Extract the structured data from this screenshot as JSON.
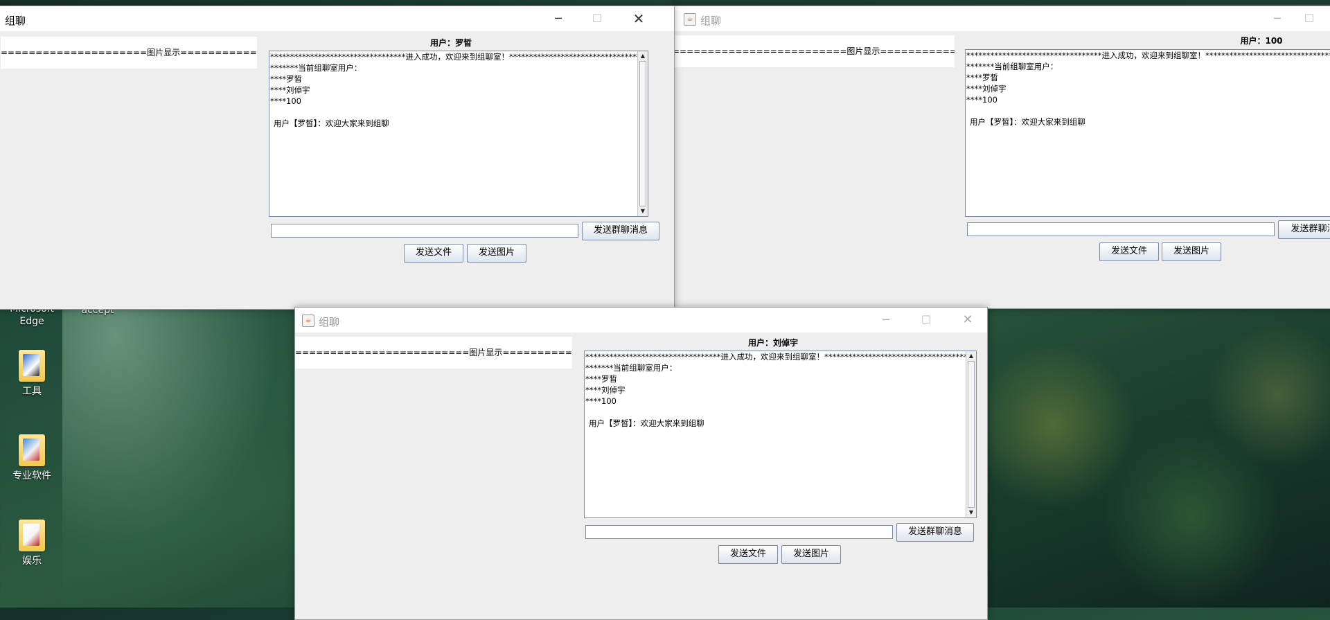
{
  "desktop": {
    "icons": [
      {
        "label_line1": "Microsoft",
        "label_line2": "Edge"
      },
      {
        "label": "accept"
      },
      {
        "label": "工具"
      },
      {
        "label": "专业软件"
      },
      {
        "label": "娱乐"
      }
    ]
  },
  "windows": {
    "w1": {
      "title": "组聊",
      "pic_header": "=====================图片显示=========================",
      "user_label": "用户：罗晳",
      "chat": [
        "**********************************进入成功，欢迎来到组聊室！************************************",
        "*******当前组聊室用户：",
        "****罗晳",
        "****刘倬宇",
        "****100",
        "用户【罗晳】：欢迎大家来到组聊"
      ],
      "send_group_label": "发送群聊消息",
      "send_file_label": "发送文件",
      "send_image_label": "发送图片"
    },
    "w2": {
      "title": "组聊",
      "pic_header": "=========================图片显示=========================",
      "user_label": "用户：100",
      "chat": [
        "**********************************进入成功，欢迎来到组聊室！************************************",
        "*******当前组聊室用户：",
        "****罗晳",
        "****刘倬宇",
        "****100",
        "用户【罗晳】：欢迎大家来到组聊"
      ],
      "send_group_label": "发送群聊消",
      "send_file_label": "发送文件",
      "send_image_label": "发送图片"
    },
    "w3": {
      "title": "组聊",
      "pic_header": "=========================图片显示=========================",
      "user_label": "用户：刘倬宇",
      "chat": [
        "**********************************进入成功，欢迎来到组聊室！************************************",
        "*******当前组聊室用户：",
        "****罗晳",
        "****刘倬宇",
        "****100",
        "用户【罗晳】：欢迎大家来到组聊"
      ],
      "send_group_label": "发送群聊消息",
      "send_file_label": "发送文件",
      "send_image_label": "发送图片"
    }
  },
  "icons": {
    "minimize": "minimize-icon",
    "maximize": "maximize-icon",
    "close": "close-icon",
    "java": "java-app-icon"
  }
}
